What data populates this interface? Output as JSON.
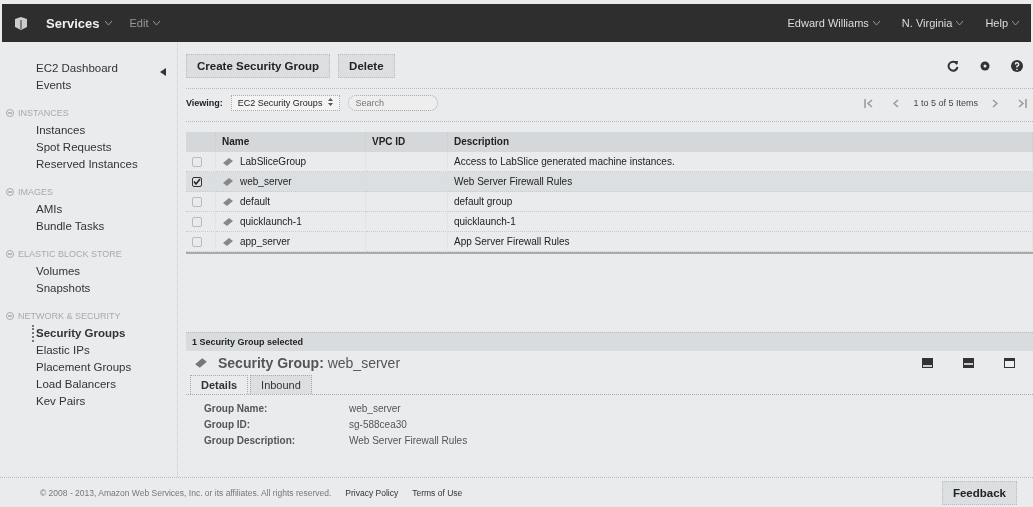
{
  "top_bar": {
    "menus": [
      {
        "label": "Services",
        "bold": true
      },
      {
        "label": "Edit",
        "bold": false
      }
    ],
    "right_menus": [
      "Edward Williams",
      "N. Virginia",
      "Help"
    ]
  },
  "sidebar": {
    "items": [
      {
        "label": "EC2 Dashboard",
        "selected": false
      },
      {
        "label": "Events",
        "selected": false
      }
    ],
    "sections": [
      {
        "title": "INSTANCES",
        "expanded": true,
        "items": [
          {
            "label": "Instances",
            "selected": false
          },
          {
            "label": "Spot Requests",
            "selected": false
          },
          {
            "label": "Reserved Instances",
            "selected": false
          }
        ]
      },
      {
        "title": "IMAGES",
        "expanded": true,
        "items": [
          {
            "label": "AMIs",
            "selected": false
          },
          {
            "label": "Bundle Tasks",
            "selected": false
          }
        ]
      },
      {
        "title": "ELASTIC BLOCK STORE",
        "expanded": true,
        "items": [
          {
            "label": "Volumes",
            "selected": false
          },
          {
            "label": "Snapshots",
            "selected": false
          }
        ]
      },
      {
        "title": "NETWORK & SECURITY",
        "expanded": true,
        "items": [
          {
            "label": "Security Groups",
            "selected": true
          },
          {
            "label": "Elastic IPs",
            "selected": false
          },
          {
            "label": "Placement Groups",
            "selected": false
          },
          {
            "label": "Load Balancers",
            "selected": false
          },
          {
            "label": "Kev Pairs",
            "selected": false
          }
        ]
      }
    ]
  },
  "toolbar": {
    "buttons": [
      "Create Security Group",
      "Delete"
    ]
  },
  "filter": {
    "label": "Viewing:",
    "select": "EC2 Security Groups",
    "search": {
      "placeholder": "Search"
    },
    "pagination": "1 to 5 of 5 Items"
  },
  "table": {
    "columns": [
      "Name",
      "VPC ID",
      "Description"
    ],
    "rows": [
      {
        "checked": false,
        "name": "LabSliceGroup",
        "vpc_id": "",
        "description": "Access to LabSlice generated machine instances."
      },
      {
        "checked": true,
        "name": "web_server",
        "vpc_id": "",
        "description": "Web Server Firewall Rules"
      },
      {
        "checked": false,
        "name": "default",
        "vpc_id": "",
        "description": "default group"
      },
      {
        "checked": false,
        "name": "quicklaunch-1",
        "vpc_id": "",
        "description": "quicklaunch-1"
      },
      {
        "checked": false,
        "name": "app_server",
        "vpc_id": "",
        "description": "App Server Firewall Rules"
      }
    ]
  },
  "detail": {
    "status": "1 Security Group selected",
    "title": "Security Group:",
    "name": "web_server",
    "tabs": [
      {
        "label": "Details",
        "selected": true
      },
      {
        "label": "Inbound",
        "selected": false
      }
    ],
    "fields": [
      {
        "label": "Group Name:",
        "value": "web_server"
      },
      {
        "label": "Group ID:",
        "value": "sg-588cea30"
      },
      {
        "label": "Group Description:",
        "value": "Web Server Firewall Rules"
      }
    ]
  },
  "footer": {
    "copyright": "© 2008 - 2013, Amazon Web Services, Inc. or its affiliates. All rights reserved.",
    "links": [
      "Privacy Policy",
      "Terms of Use"
    ],
    "feedback": "Feedback"
  }
}
